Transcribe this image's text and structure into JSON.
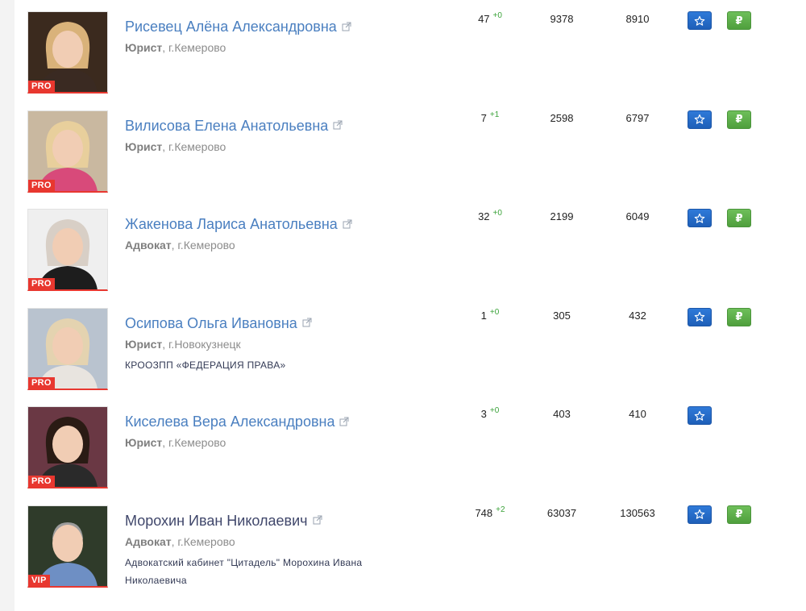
{
  "lawyers": [
    {
      "name": "Рисевец Алёна Александровна",
      "role": "Юрист",
      "city": ", г.Кемерово",
      "org": "",
      "badge": "PRO",
      "rating": "47",
      "rating_delta": "+0",
      "stat2": "9378",
      "stat3": "8910",
      "has_pay": true
    },
    {
      "name": "Вилисова Елена Анатольевна",
      "role": "Юрист",
      "city": ", г.Кемерово",
      "org": "",
      "badge": "PRO",
      "rating": "7",
      "rating_delta": "+1",
      "stat2": "2598",
      "stat3": "6797",
      "has_pay": true
    },
    {
      "name": "Жакенова Лариса Анатольевна",
      "role": "Адвокат",
      "city": ", г.Кемерово",
      "org": "",
      "badge": "PRO",
      "rating": "32",
      "rating_delta": "+0",
      "stat2": "2199",
      "stat3": "6049",
      "has_pay": true
    },
    {
      "name": "Осипова Ольга Ивановна",
      "role": "Юрист",
      "city": ", г.Новокузнецк",
      "org": "КРООЗПП «ФЕДЕРАЦИЯ ПРАВА»",
      "badge": "PRO",
      "rating": "1",
      "rating_delta": "+0",
      "stat2": "305",
      "stat3": "432",
      "has_pay": true
    },
    {
      "name": "Киселева Вера Александровна",
      "role": "Юрист",
      "city": ", г.Кемерово",
      "org": "",
      "badge": "PRO",
      "rating": "3",
      "rating_delta": "+0",
      "stat2": "403",
      "stat3": "410",
      "has_pay": false
    },
    {
      "name": "Морохин Иван Николаевич",
      "role": "Адвокат",
      "city": ", г.Кемерово",
      "org": "Адвокатский кабинет \"Цитадель\" Морохина Ивана Николаевича",
      "badge": "VIP",
      "rating": "748",
      "rating_delta": "+2",
      "stat2": "63037",
      "stat3": "130563",
      "has_pay": true
    }
  ],
  "buttons": {
    "favorite_icon": "star-icon",
    "pay_symbol": "₽"
  },
  "colors": {
    "link": "#4a7fc0",
    "vip_link": "#40476b",
    "badge": "#e8372f",
    "delta": "#3ba33a",
    "star_btn": "#2f7ad9",
    "pay_btn": "#5aae47"
  }
}
